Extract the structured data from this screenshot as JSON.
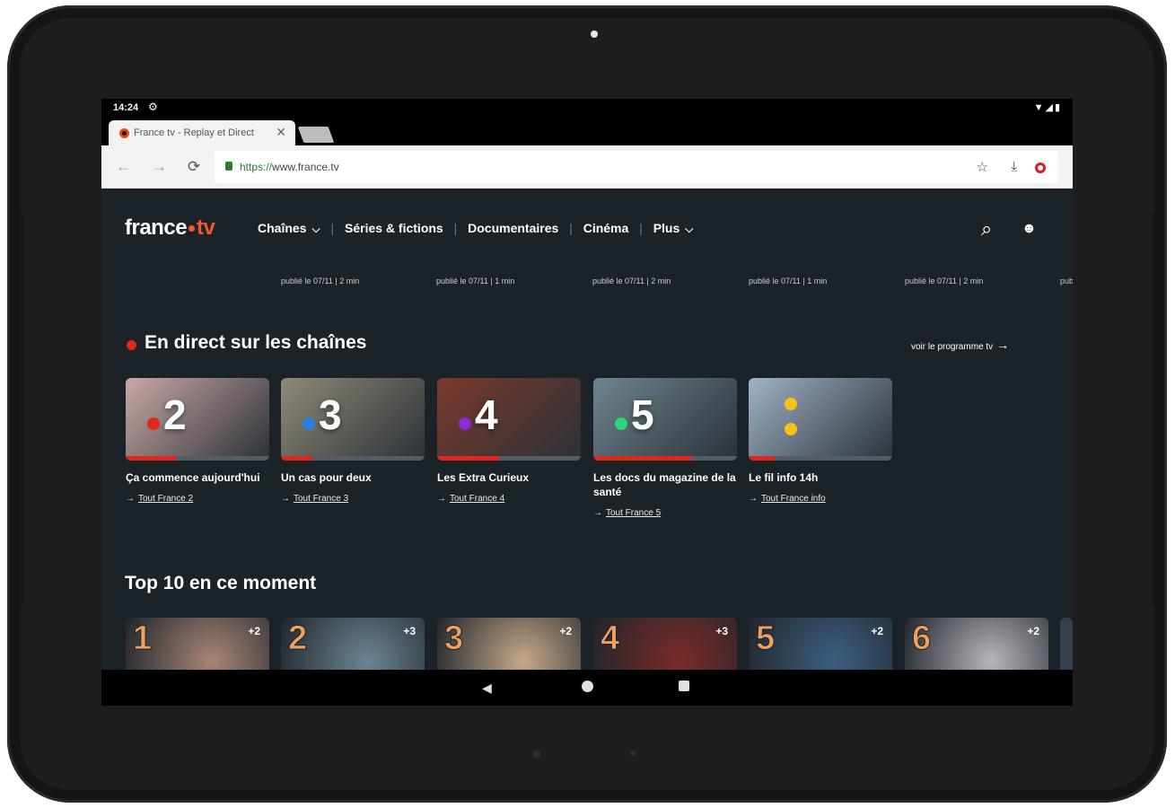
{
  "status_bar": {
    "time": "14:24",
    "settings_icon": "gear-icon",
    "right_icons": "▼◢▮"
  },
  "browser": {
    "tab_title": "France tv - Replay et Direct",
    "tab_close": "✕",
    "url_scheme": "https://",
    "url_host": "www.france.tv",
    "back": "←",
    "forward": "→",
    "reload": "⟳",
    "bookmark": "☆",
    "download": "⤓"
  },
  "site": {
    "logo_text": "france",
    "logo_tv": "tv",
    "nav": [
      {
        "label": "Chaînes",
        "has_dropdown": true
      },
      {
        "label": "Séries & fictions"
      },
      {
        "label": "Documentaires"
      },
      {
        "label": "Cinéma"
      },
      {
        "label": "Plus",
        "has_dropdown": true
      }
    ],
    "separator": "|",
    "chevron": "⌵",
    "search_icon": "⌕",
    "account_icon": "👤"
  },
  "published": [
    "publié le 07/11 | 2 min",
    "publié le 07/11 | 1 min",
    "publié le 07/11 | 2 min",
    "publié le 07/11 | 1 min",
    "publié le 07/11 | 2 min",
    "publi"
  ],
  "live_section": {
    "title": "En direct sur les chaînes",
    "program_link": "voir le programme tv",
    "program_arrow": "→",
    "channels": [
      {
        "number": "2",
        "dot_color": "#e1271c",
        "bg": "#c9a8a6",
        "progress": 0.35,
        "name": "Ça commence aujourd'hui",
        "link": "Tout France 2"
      },
      {
        "number": "3",
        "dot_color": "#2f7de1",
        "bg": "#8f8a78",
        "progress": 0.22,
        "name": "Un cas pour deux",
        "link": "Tout France 3"
      },
      {
        "number": "4",
        "dot_color": "#8e2bd6",
        "bg": "#7a3a2c",
        "progress": 0.43,
        "name": "Les Extra Curieux",
        "link": "Tout France 4"
      },
      {
        "number": "5",
        "dot_color": "#2bd67a",
        "bg": "#6f8590",
        "progress": 0.68,
        "name": "Les docs du magazine de la santé",
        "link": "Tout France 5"
      },
      {
        "number": "",
        "dot_color": "#f6c21b",
        "bg": "#9fb3c8",
        "progress": 0.18,
        "name": "Le fil info 14h",
        "link": "Tout France info"
      }
    ],
    "link_arrow": "→"
  },
  "top10": {
    "title": "Top 10 en ce moment",
    "items": [
      {
        "rank": "1",
        "badge": "+2",
        "bg": "#a98576"
      },
      {
        "rank": "2",
        "badge": "+3",
        "bg": "#6c8493"
      },
      {
        "rank": "3",
        "badge": "+2",
        "bg": "#c7a98a"
      },
      {
        "rank": "4",
        "badge": "+3",
        "bg": "#7b2a27"
      },
      {
        "rank": "5",
        "badge": "+2",
        "bg": "#3d5f80"
      },
      {
        "rank": "6",
        "badge": "+2",
        "bg": "#b9b5bd"
      }
    ]
  },
  "android_nav": {
    "back": "◀"
  }
}
